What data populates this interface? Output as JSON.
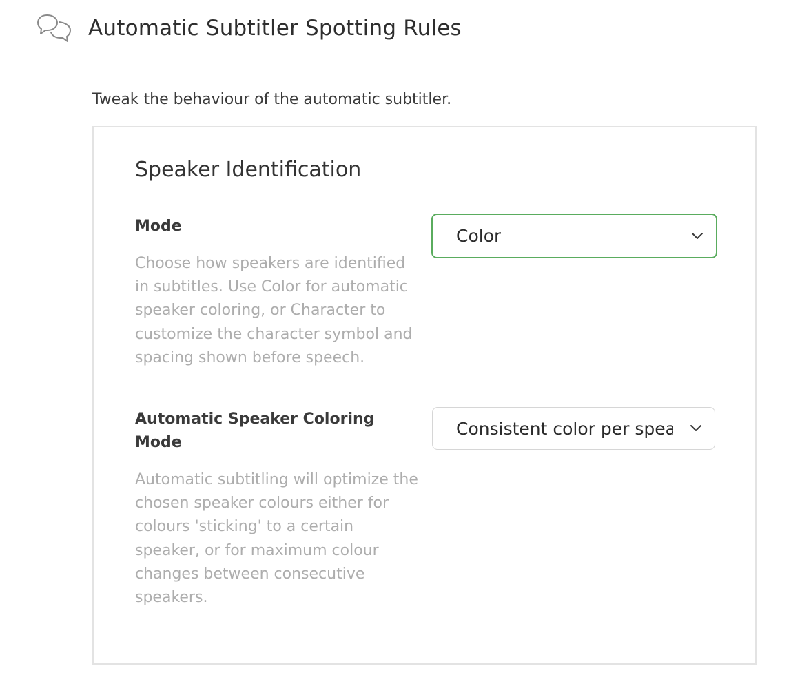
{
  "page": {
    "title": "Automatic Subtitler Spotting Rules",
    "icon": "chat-bubbles-icon",
    "intro": "Tweak the behaviour of the automatic subtitler."
  },
  "panel": {
    "section_title": "Speaker Identification",
    "settings": [
      {
        "label": "Mode",
        "description": "Choose how speakers are identified in subtitles. Use Color for automatic speaker coloring, or Character to customize the character symbol and spacing shown before speech.",
        "selected": "Color",
        "focused": true
      },
      {
        "label": "Automatic Speaker Coloring Mode",
        "description": "Automatic subtitling will optimize the chosen speaker colours either for colours 'sticking' to a certain speaker, or for maximum colour changes between consecutive speakers.",
        "selected": "Consistent color per speaker",
        "focused": false
      }
    ]
  },
  "colors": {
    "focus_border": "#5aac5e",
    "default_border": "#d6d6d6",
    "description_text": "#adadad",
    "panel_border": "#e3e3e3"
  }
}
